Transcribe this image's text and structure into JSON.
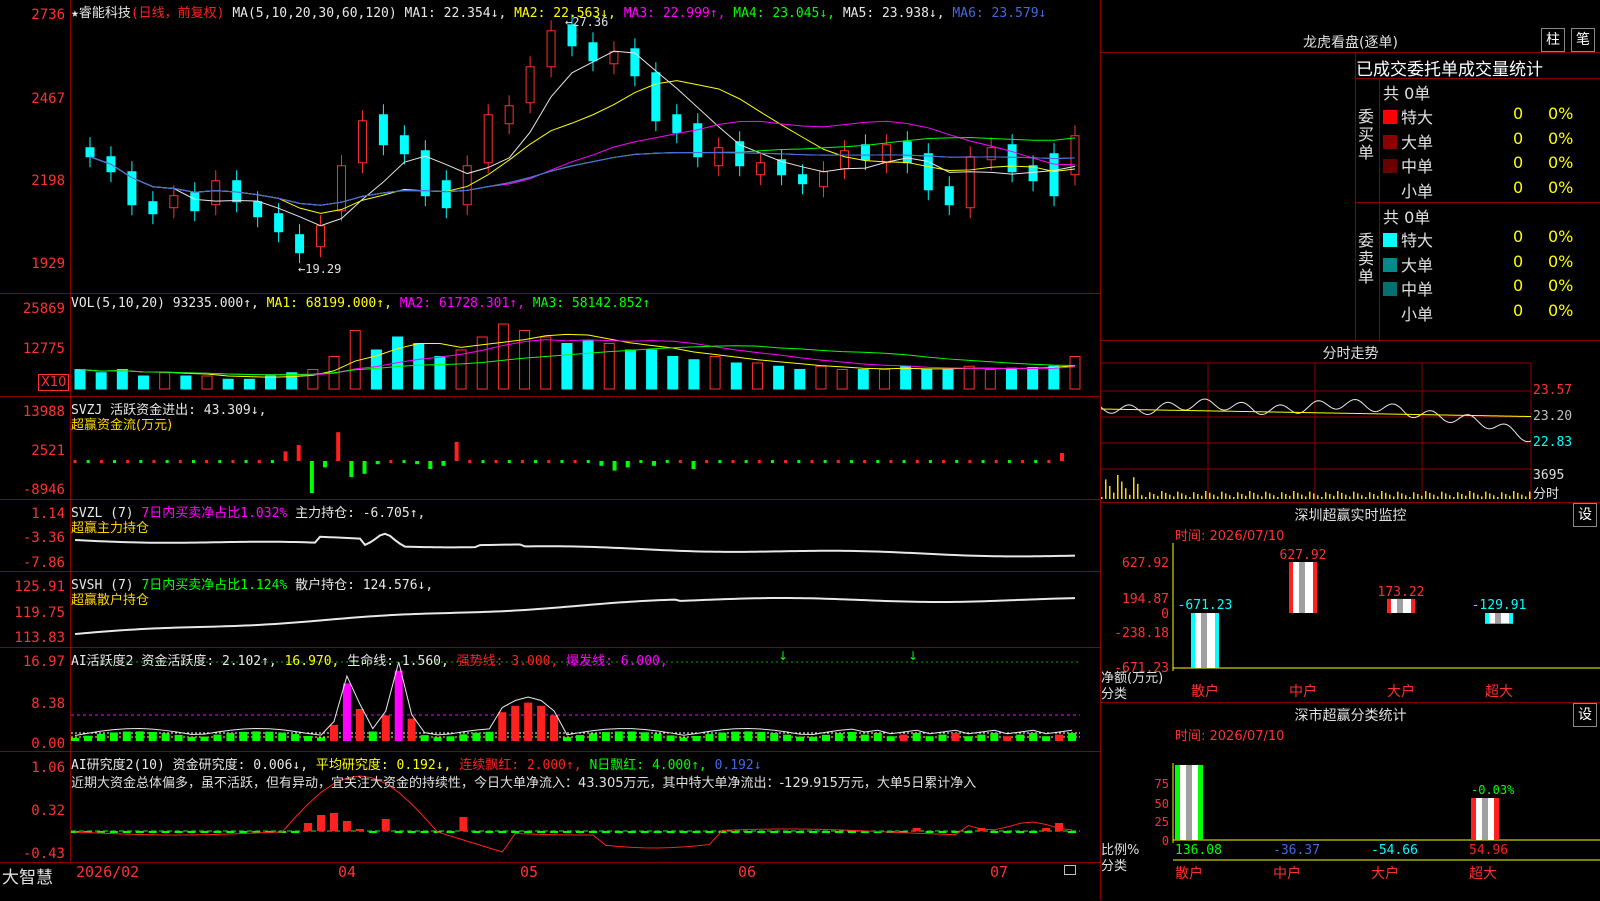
{
  "kline": {
    "stock": "睿能科技",
    "mode": "(日线，前复权)",
    "ma_label": "MA(5,10,20,30,60,120)",
    "ma1": "MA1: 22.354↓,",
    "ma2": "MA2: 22.563↓,",
    "ma3": "MA3: 22.999↑,",
    "ma4": "MA4: 23.045↓,",
    "ma5": "MA5: 23.938↓,",
    "ma6": "MA6: 23.579↓",
    "yticks": [
      "2736",
      "2467",
      "2198",
      "1929"
    ],
    "high_label": "27.36",
    "low_label": "19.29",
    "close": [
      22.8,
      22.3,
      21.2,
      20.9,
      21.5,
      21.0,
      22.0,
      21.3,
      20.8,
      20.3,
      19.6,
      20.5,
      22.5,
      24.0,
      23.2,
      22.9,
      21.5,
      21.1,
      22.5,
      24.2,
      24.5,
      25.8,
      27.0,
      26.5,
      26.0,
      26.3,
      25.5,
      24.0,
      23.6,
      22.8,
      23.1,
      22.5,
      22.6,
      22.2,
      21.9,
      22.3,
      23.0,
      22.7,
      23.2,
      22.6,
      21.7,
      21.2,
      22.8,
      23.1,
      22.3,
      22.0,
      21.5,
      23.5
    ],
    "open": [
      23.1,
      22.8,
      22.3,
      21.3,
      21.1,
      21.6,
      21.2,
      22.0,
      21.3,
      20.9,
      20.2,
      19.8,
      21.0,
      22.6,
      24.2,
      23.5,
      23.0,
      22.0,
      21.2,
      22.6,
      23.9,
      24.6,
      25.8,
      27.2,
      26.6,
      25.9,
      26.4,
      25.6,
      24.2,
      23.9,
      22.5,
      23.3,
      22.2,
      22.7,
      22.2,
      21.8,
      22.4,
      23.2,
      22.6,
      23.3,
      22.9,
      21.8,
      21.1,
      22.7,
      23.2,
      22.5,
      22.9,
      22.2
    ]
  },
  "vol": {
    "title": "VOL(5,10,20)",
    "cur": "93235.000↑,",
    "ma1": "MA1: 68199.000↑,",
    "ma2": "MA2: 61728.301↑,",
    "ma3": "MA3: 58142.852↑",
    "yticks": [
      "25869",
      "12775"
    ],
    "unit": "X10",
    "values": [
      3,
      2.5,
      3,
      2,
      2.5,
      2,
      2,
      1.5,
      1.5,
      2,
      2.5,
      3,
      5,
      9,
      6,
      8,
      7,
      5,
      6,
      8,
      10,
      9,
      8,
      7,
      7.5,
      7,
      6,
      6,
      5,
      4.5,
      5,
      4,
      4,
      3.5,
      3,
      3.5,
      3,
      3,
      3,
      3.5,
      3,
      3,
      3.5,
      3,
      3.2,
      3.3,
      3.5,
      5
    ]
  },
  "svzj": {
    "title": "SVZJ",
    "label": "活跃资金进出: 43.309↓,",
    "sub": "超赢资金流(万元)",
    "yticks": [
      "13988",
      "2521",
      "-8946"
    ],
    "values": [
      0,
      0,
      0,
      0,
      0,
      0,
      0,
      0,
      0,
      0,
      0,
      0,
      0,
      0,
      0,
      0,
      6,
      10,
      -20,
      -4,
      18,
      -10,
      -8,
      -2,
      0,
      0,
      -2,
      -5,
      -3,
      12,
      0,
      0,
      0,
      0,
      0,
      0,
      0,
      0,
      0,
      0,
      -3,
      -6,
      -4,
      0,
      -3,
      0,
      0,
      -5,
      0,
      0,
      0,
      0,
      0,
      0,
      0,
      0,
      0,
      0,
      0,
      0,
      0,
      0,
      0,
      0,
      0,
      0,
      0,
      0,
      0,
      0,
      0,
      0,
      0,
      0,
      0,
      5
    ]
  },
  "svzl": {
    "title": "SVZL (7)",
    "pct": "7日内买卖净占比1.032%",
    "label": "主力持仓: -6.705↑,",
    "sub": "超赢主力持仓",
    "yticks": [
      "1.14",
      "-3.36",
      "-7.86"
    ]
  },
  "svsh": {
    "title": "SVSH (7)",
    "pct": "7日内买卖净占比1.124%",
    "label": "散户持仓: 124.576↓,",
    "sub": "超赢散户持仓",
    "yticks": [
      "125.91",
      "119.75",
      "113.83"
    ]
  },
  "ai1": {
    "title": "AI活跃度2",
    "label": "资金活跃度: 2.102↑,",
    "v2": "16.970,",
    "life": "生命线: 1.560,",
    "strong": "强势线: 3.000,",
    "burst": "爆发线: 6.000,",
    "yticks": [
      "16.97",
      "8.38",
      "0.00"
    ]
  },
  "ai2": {
    "title": "AI研究度2(10)",
    "label": "资金研究度: 0.006↓,",
    "avg": "平均研究度: 0.192↓,",
    "streak": "连续飘红: 2.000↑,",
    "nday": "N日飘红: 4.000↑,",
    "last": "0.192↓",
    "note": "近期大资金总体偏多，虽不活跃，但有异动，宜关注大资金的持续性，今日大单净流入：43.305万元，其中特大单净流出：-129.915万元，大单5日累计净入",
    "yticks": [
      "1.06",
      "0.32",
      "-0.43"
    ]
  },
  "xaxis": {
    "labels": [
      "2026/02",
      "04",
      "05",
      "06",
      "07"
    ],
    "brand": "大智慧"
  },
  "right": {
    "lhb_title": "龙虎看盘(逐单)",
    "btn1": "柱",
    "btn2": "笔",
    "header": "已成交委托单成交量统计",
    "buy_side": "委买单",
    "sell_side": "委卖单",
    "buy_total": "共 0单",
    "sell_total": "共 0单",
    "buy_rows": [
      {
        "label": "特大",
        "n": "0",
        "p": "0%",
        "color": "#ff0000"
      },
      {
        "label": "大单",
        "n": "0",
        "p": "0%",
        "color": "#8b0000"
      },
      {
        "label": "中单",
        "n": "0",
        "p": "0%",
        "color": "#6b0000"
      },
      {
        "label": "小单",
        "n": "0",
        "p": "0%",
        "color": "#000000"
      }
    ],
    "sell_rows": [
      {
        "label": "特大",
        "n": "0",
        "p": "0%",
        "color": "#00ffff"
      },
      {
        "label": "大单",
        "n": "0",
        "p": "0%",
        "color": "#008b8b"
      },
      {
        "label": "中单",
        "n": "0",
        "p": "0%",
        "color": "#007070"
      },
      {
        "label": "小单",
        "n": "0",
        "p": "0%",
        "color": "#000000"
      }
    ],
    "fs_title": "分时走势",
    "fs_yticks": [
      "23.57",
      "23.20",
      "22.83"
    ],
    "fs_vol": "3695",
    "fs_unit": "分时",
    "sz_title": "深圳超赢实时监控",
    "sz_btn": "设",
    "sz_time": "时间: 2026/07/10",
    "sz_yticks": [
      "627.92",
      "194.87",
      "0",
      "-238.18",
      "-671.23"
    ],
    "sz_ylabel": "净额(万元)",
    "sz_xlabel": "分类",
    "sz_bars": [
      {
        "cat": "散户",
        "value": -671.23,
        "label": "-671.23"
      },
      {
        "cat": "中户",
        "value": 627.92,
        "label": "627.92"
      },
      {
        "cat": "大户",
        "value": 173.22,
        "label": "173.22"
      },
      {
        "cat": "超大",
        "value": -129.91,
        "label": "-129.91"
      }
    ],
    "fl_title": "深市超赢分类统计",
    "fl_btn": "设",
    "fl_time": "时间: 2026/07/10",
    "fl_yticks": [
      "75",
      "50",
      "25",
      "0"
    ],
    "fl_ylabel": "比例%",
    "fl_xlabel": "分类",
    "fl_pct": "-0.03%",
    "fl_cats": [
      {
        "cat": "散户",
        "value": "136.08",
        "color": "#00ff00"
      },
      {
        "cat": "中户",
        "value": "-36.37",
        "color": "#4169e1"
      },
      {
        "cat": "大户",
        "value": "-54.66",
        "color": "#00ffff"
      },
      {
        "cat": "超大",
        "value": "54.96",
        "color": "#ff2020"
      }
    ]
  }
}
